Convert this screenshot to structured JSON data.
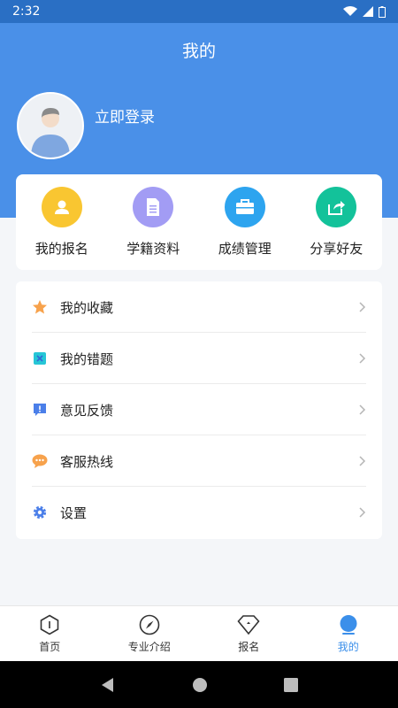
{
  "status_bar": {
    "time": "2:32"
  },
  "header": {
    "title": "我的"
  },
  "profile": {
    "login_text": "立即登录"
  },
  "quick_actions": [
    {
      "label": "我的报名",
      "icon": "user-icon",
      "color": "#f9c631"
    },
    {
      "label": "学籍资料",
      "icon": "document-icon",
      "color": "#a29cf4"
    },
    {
      "label": "成绩管理",
      "icon": "briefcase-icon",
      "color": "#2da4ef"
    },
    {
      "label": "分享好友",
      "icon": "share-icon",
      "color": "#13c29a"
    }
  ],
  "menu": [
    {
      "label": "我的收藏",
      "icon": "star-icon",
      "color": "#f7a24c"
    },
    {
      "label": "我的错题",
      "icon": "error-icon",
      "color": "#26c6d6"
    },
    {
      "label": "意见反馈",
      "icon": "feedback-icon",
      "color": "#4b7fe9"
    },
    {
      "label": "客服热线",
      "icon": "chat-icon",
      "color": "#f7a24c"
    },
    {
      "label": "设置",
      "icon": "gear-icon",
      "color": "#4b7fe9"
    }
  ],
  "tabs": [
    {
      "label": "首页",
      "icon": "home-icon"
    },
    {
      "label": "专业介绍",
      "icon": "compass-icon"
    },
    {
      "label": "报名",
      "icon": "signup-icon"
    },
    {
      "label": "我的",
      "icon": "profile-icon",
      "active": true
    }
  ],
  "colors": {
    "primary": "#4a90e8",
    "accent": "#3b8fea"
  }
}
